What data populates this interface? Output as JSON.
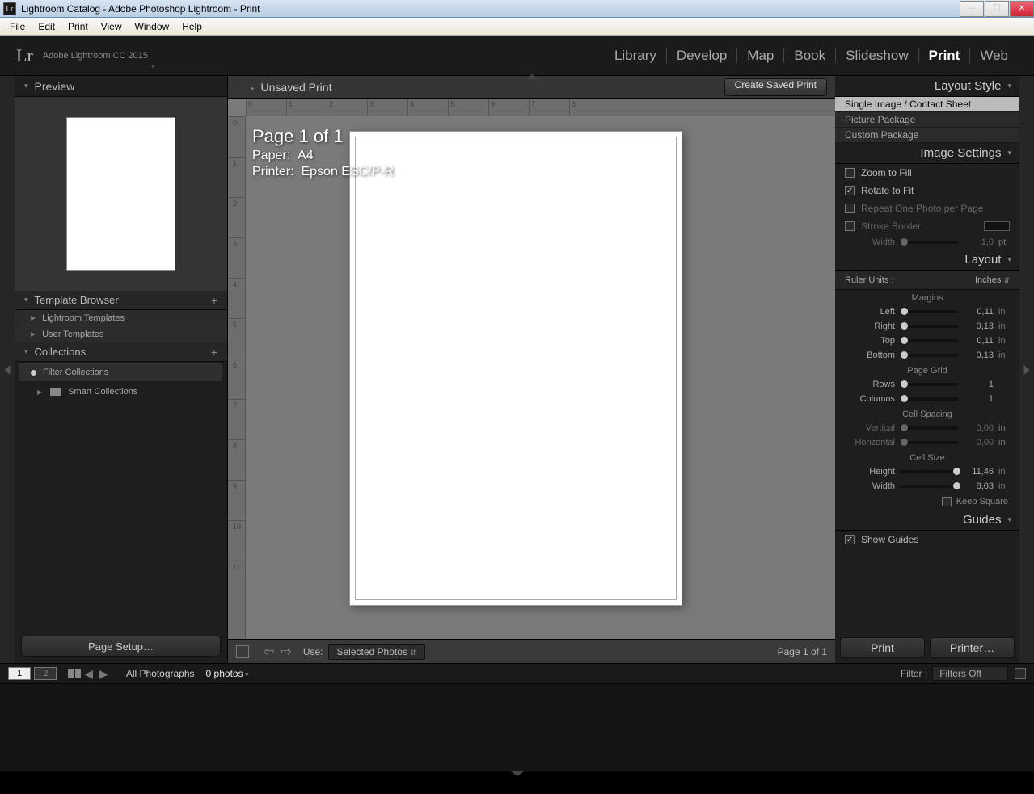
{
  "window": {
    "title": "Lightroom Catalog - Adobe Photoshop Lightroom - Print"
  },
  "menubar": {
    "file": "File",
    "edit": "Edit",
    "print": "Print",
    "view": "View",
    "window": "Window",
    "help": "Help"
  },
  "header": {
    "logo": "Lr",
    "subtitle": "Adobe Lightroom CC 2015"
  },
  "modules": {
    "library": "Library",
    "develop": "Develop",
    "map": "Map",
    "book": "Book",
    "slideshow": "Slideshow",
    "print": "Print",
    "web": "Web"
  },
  "left": {
    "preview": "Preview",
    "template_browser": "Template Browser",
    "templates": {
      "lr": "Lightroom Templates",
      "user": "User Templates"
    },
    "collections": "Collections",
    "filter_collections": "Filter Collections",
    "smart_collections": "Smart Collections",
    "page_setup": "Page Setup…"
  },
  "center": {
    "unsaved": "Unsaved Print",
    "create_saved": "Create Saved Print",
    "page_title": "Page 1 of 1",
    "paper_label": "Paper:",
    "paper": "A4",
    "printer_label": "Printer:",
    "printer": "Epson ESC/P-R",
    "use_label": "Use:",
    "use_value": "Selected Photos",
    "page_indicator": "Page 1 of 1"
  },
  "right": {
    "layout_style": "Layout Style",
    "styles": {
      "single": "Single Image / Contact Sheet",
      "picture": "Picture Package",
      "custom": "Custom Package"
    },
    "image_settings": "Image Settings",
    "zoom_fill": "Zoom to Fill",
    "rotate_fit": "Rotate to Fit",
    "repeat_one": "Repeat One Photo per Page",
    "stroke_border": "Stroke Border",
    "stroke_width_label": "Width",
    "stroke_width_val": "1,0",
    "layout": "Layout",
    "ruler_units_label": "Ruler Units :",
    "ruler_units": "Inches",
    "margins": "Margins",
    "margin": {
      "left_l": "Left",
      "left_v": "0,11",
      "right_l": "Right",
      "right_v": "0,13",
      "top_l": "Top",
      "top_v": "0,11",
      "bottom_l": "Bottom",
      "bottom_v": "0,13"
    },
    "page_grid": "Page Grid",
    "grid": {
      "rows_l": "Rows",
      "rows_v": "1",
      "cols_l": "Columns",
      "cols_v": "1"
    },
    "cell_spacing": "Cell Spacing",
    "spacing": {
      "v_l": "Vertical",
      "v_v": "0,00",
      "h_l": "Horizontal",
      "h_v": "0,00"
    },
    "cell_size": "Cell Size",
    "cell": {
      "h_l": "Height",
      "h_v": "11,46",
      "w_l": "Width",
      "w_v": "8,03"
    },
    "keep_square": "Keep Square",
    "guides": "Guides",
    "show_guides": "Show Guides",
    "print_btn": "Print",
    "printer_btn": "Printer…",
    "unit_in": "in",
    "unit_pt": "pt"
  },
  "filmstrip": {
    "primary": "1",
    "secondary": "2",
    "location": "All Photographs",
    "count": "0 photos",
    "filter_label": "Filter :",
    "filter_value": "Filters Off"
  }
}
